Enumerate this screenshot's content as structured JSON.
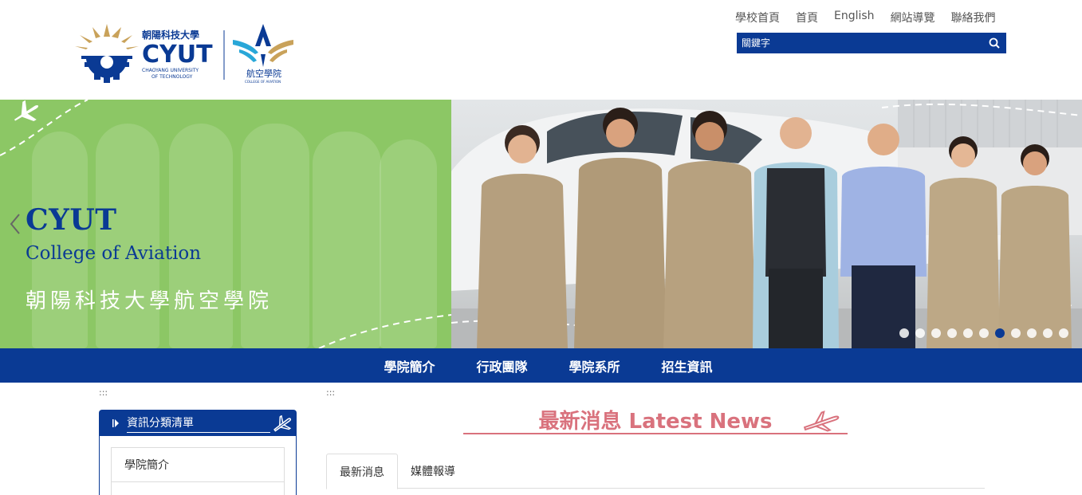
{
  "header": {
    "logo": {
      "university_zh": "朝陽科技大學",
      "university_abbr": "CYUT",
      "university_en_line1": "CHAOYANG UNIVERSITY",
      "university_en_line2": "OF TECHNOLOGY",
      "college_zh": "航空學院",
      "college_en": "COLLEGE OF AVIATION"
    },
    "top_links": [
      "學校首頁",
      "首頁",
      "English",
      "網站導覽",
      "聯絡我們"
    ],
    "search": {
      "placeholder": "關鍵字",
      "icon": "search-icon"
    }
  },
  "banner": {
    "title": "CYUT",
    "subtitle": "College of Aviation",
    "title_zh": "朝陽科技大學航空學院",
    "slide_count": 11,
    "active_slide": 7
  },
  "nav": {
    "items": [
      "學院簡介",
      "行政團隊",
      "學院系所",
      "招生資訊"
    ]
  },
  "markers": {
    "left": ":::",
    "right": ":::"
  },
  "sidebar": {
    "title": "資訊分類清單",
    "items": [
      "學院簡介"
    ]
  },
  "news": {
    "heading": "最新消息 Latest News",
    "tabs": [
      {
        "label": "最新消息",
        "active": true
      },
      {
        "label": "媒體報導",
        "active": false
      }
    ]
  },
  "colors": {
    "brand_blue": "#0a3a94",
    "banner_green": "#8cc765",
    "news_pink": "#d9727d",
    "logo_gold": "#c9a25a"
  }
}
